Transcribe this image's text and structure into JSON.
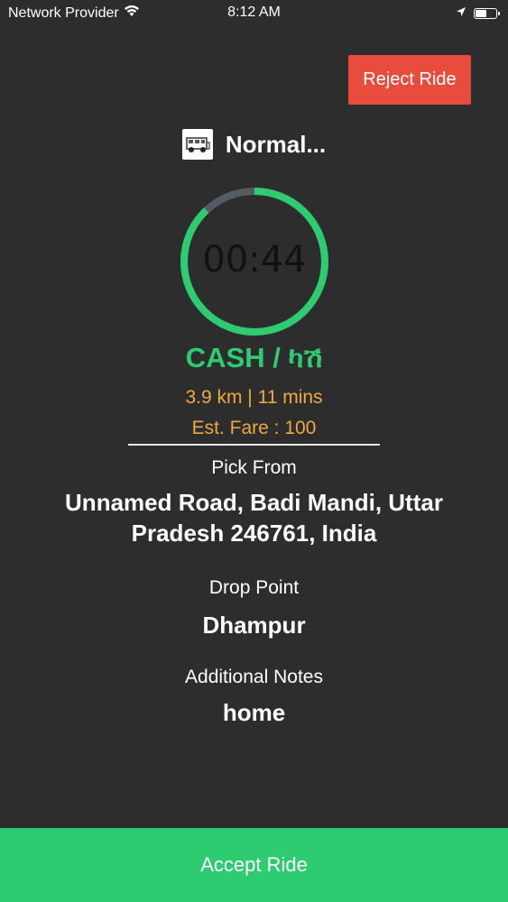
{
  "status_bar": {
    "carrier": "Network Provider",
    "time": "8:12 AM",
    "battery_level": 0.6
  },
  "reject_button": {
    "label": "Reject Ride"
  },
  "vehicle": {
    "name": "Normal..."
  },
  "timer": {
    "display": "00:44",
    "remaining_fraction": 0.88,
    "colors": {
      "progress": "#2ecc71",
      "track": "#555b66"
    }
  },
  "trip": {
    "payment": "CASH / ካሽ",
    "distance_time": "3.9 km | 11 mins",
    "fare": "Est. Fare : 100"
  },
  "pickup": {
    "label": "Pick From",
    "value": "Unnamed Road, Badi Mandi, Uttar Pradesh 246761, India"
  },
  "drop": {
    "label": "Drop Point",
    "value": "Dhampur"
  },
  "notes": {
    "label": "Additional Notes",
    "value": "home"
  },
  "accept_button": {
    "label": "Accept Ride"
  },
  "colors": {
    "background": "#2d2d2d",
    "accent_green": "#2ecc71",
    "reject_red": "#e74c3c",
    "fare_orange": "#f0a940"
  }
}
